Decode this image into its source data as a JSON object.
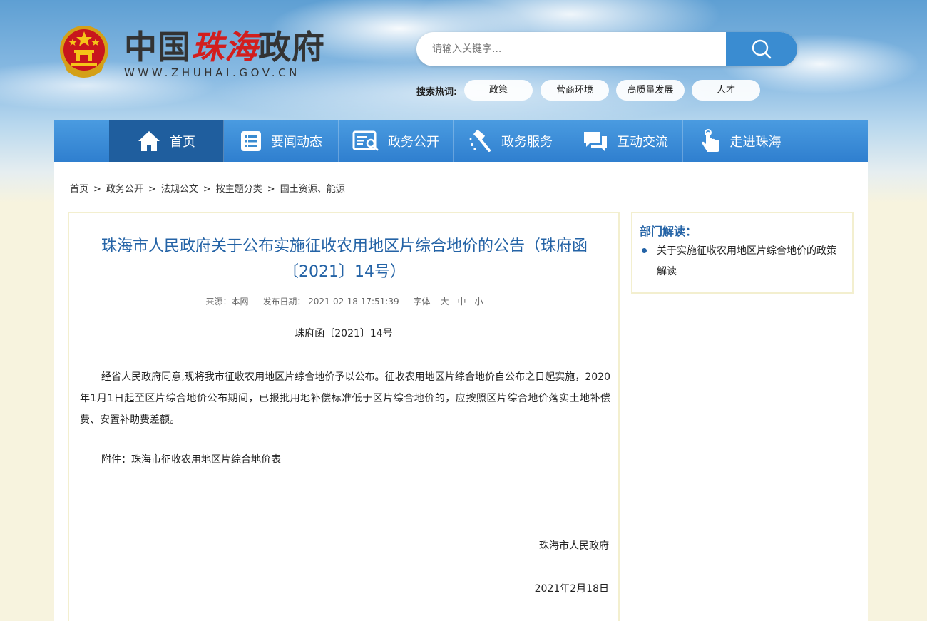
{
  "header": {
    "logo_text_part1": "中国",
    "logo_text_part2": "珠海",
    "logo_text_part3": "政府",
    "logo_url": "WWW.ZHUHAI.GOV.CN",
    "emblem_icon": "national-emblem-icon"
  },
  "search": {
    "placeholder": "请输入关键字...",
    "button_icon": "search-icon",
    "hot_label": "搜索热词:",
    "hot_tags": [
      "政策",
      "营商环境",
      "高质量发展",
      "人才"
    ]
  },
  "nav": {
    "items": [
      {
        "label": "首页",
        "icon": "home-icon"
      },
      {
        "label": "要闻动态",
        "icon": "news-list-icon"
      },
      {
        "label": "政务公开",
        "icon": "document-search-icon"
      },
      {
        "label": "政务服务",
        "icon": "hammer-service-icon"
      },
      {
        "label": "互动交流",
        "icon": "chat-bubble-icon"
      },
      {
        "label": "走进珠海",
        "icon": "pointer-hand-icon"
      }
    ],
    "active_index": 0,
    "color": "#2f7fcf",
    "active_color": "#1f5e9e"
  },
  "breadcrumb": [
    "首页",
    "政务公开",
    "法规公文",
    "按主题分类",
    "国土资源、能源"
  ],
  "breadcrumb_sep": ">",
  "article": {
    "title_line1": "珠海市人民政府关于公布实施征收农用地区片综合地价的公告（珠府函",
    "title_line2": "〔2021〕14号）",
    "source": "来源：本网",
    "publish_date": "发布日期： 2021-02-18 17:51:39",
    "font_size_label": "字体",
    "font_sizes": [
      "大",
      "中",
      "小"
    ],
    "doc_number": "珠府函〔2021〕14号",
    "body": "经省人民政府同意,现将我市征收农用地区片综合地价予以公布。征收农用地区片综合地价自公布之日起实施，2020年1月1日起至区片综合地价公布期间，已报批用地补偿标准低于区片综合地价的，应按照区片综合地价落实土地补偿费、安置补助费差额。",
    "attachment": "附件：珠海市征收农用地区片综合地价表",
    "signer": "珠海市人民政府",
    "sign_date": "2021年2月18日",
    "title_color": "#2463a6"
  },
  "sidebar": {
    "title": "部门解读：",
    "links": [
      "关于实施征收农用地区片综合地价的政策解读"
    ]
  }
}
